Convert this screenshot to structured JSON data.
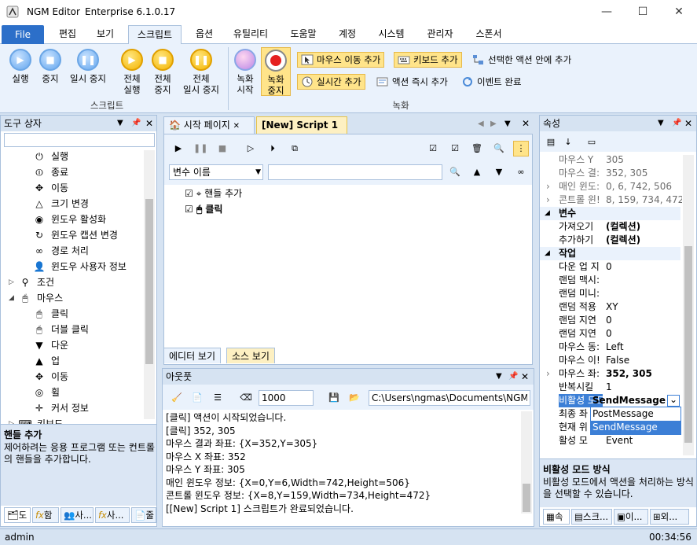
{
  "window": {
    "app": "NGM Editor",
    "edition": "Enterprise 6.1.0.17",
    "minimize": "—",
    "maximize": "☐",
    "close": "✕"
  },
  "menu": [
    {
      "label": "File"
    },
    {
      "label": "편집"
    },
    {
      "label": "보기"
    },
    {
      "label": "스크립트"
    },
    {
      "label": "옵션"
    },
    {
      "label": "유틸리티"
    },
    {
      "label": "도움말"
    },
    {
      "label": "계정"
    },
    {
      "label": "시스템"
    },
    {
      "label": "관리자"
    },
    {
      "label": "스폰서"
    }
  ],
  "ribbon": {
    "script_group": "스크립트",
    "record_group": "녹화",
    "run": "실행",
    "stop": "중지",
    "pause": "일시 중지",
    "run_all": [
      "전체",
      "실행"
    ],
    "stop_all": [
      "전체",
      "중지"
    ],
    "pause_all": [
      "전체",
      "일시 중지"
    ],
    "rec_start": [
      "녹화",
      "시작"
    ],
    "rec_stop": [
      "녹화",
      "중지"
    ],
    "add_mouse_move": "마우스 이동 추가",
    "add_keyboard": "키보드 추가",
    "add_in_selected": "선택한 액션 안에 추가",
    "add_realtime": "실시간 추가",
    "run_action_now": "액션 즉시 추가",
    "event_done": "이벤트 완료"
  },
  "toolbox": {
    "title": "도구 상자",
    "search_placeholder": "",
    "items": [
      {
        "label": "실행",
        "icon": "run-icon"
      },
      {
        "label": "종료",
        "icon": "power-icon"
      },
      {
        "label": "이동",
        "icon": "move-icon"
      },
      {
        "label": "크기 변경",
        "icon": "resize-icon"
      },
      {
        "label": "윈도우 활성화",
        "icon": "activate-icon"
      },
      {
        "label": "윈도우 캡션 변경",
        "icon": "caption-icon"
      },
      {
        "label": "경로 처리",
        "icon": "path-icon"
      },
      {
        "label": "윈도우 사용자 정보",
        "icon": "user-icon"
      },
      {
        "label": "조건",
        "icon": "condition-icon"
      },
      {
        "label": "마우스",
        "icon": "mouse-icon"
      },
      {
        "label": "클릭",
        "icon": "click-icon"
      },
      {
        "label": "더블 클릭",
        "icon": "double-click-icon"
      },
      {
        "label": "다운",
        "icon": "mouse-down-icon"
      },
      {
        "label": "업",
        "icon": "mouse-up-icon"
      },
      {
        "label": "이동",
        "icon": "mouse-move-icon"
      },
      {
        "label": "휠",
        "icon": "wheel-icon"
      },
      {
        "label": "커서 정보",
        "icon": "cursor-icon"
      },
      {
        "label": "키보드",
        "icon": "keyboard-icon"
      }
    ],
    "desc_title": "핸들 추가",
    "desc_text": "제어하려는 응용 프로그램 또는 컨트롤의 핸들을 추가합니다.",
    "tabs": [
      "도",
      "함",
      "사...",
      "사...",
      "줄"
    ]
  },
  "editor": {
    "tabs": [
      {
        "label": "시작 페이지"
      },
      {
        "label": "[New] Script 1"
      }
    ],
    "var_select": "변수 이름",
    "var_input": "",
    "script_items": [
      {
        "label": "핸들 추가",
        "checked": true
      },
      {
        "label": "클릭",
        "checked": true
      }
    ],
    "bottom_tabs": [
      "에디터 보기",
      "소스 보기"
    ]
  },
  "output": {
    "title": "아웃풋",
    "count": "1000",
    "path": "C:\\Users\\ngmas\\Documents\\NGM6\\",
    "lines": [
      "[클릭] 액션이 시작되었습니다.",
      "[클릭] 352, 305",
      "마우스 결과 좌표: {X=352,Y=305}",
      "마우스 X 좌표: 352",
      "마우스 Y 좌표: 305",
      "매인 윈도우 정보: {X=0,Y=6,Width=742,Height=506}",
      "콘트롤 윈도우 정보: {X=8,Y=159,Width=734,Height=472}",
      "[[New] Script 1] 스크립트가 완료되었습니다."
    ]
  },
  "properties": {
    "title": "속성",
    "rows": [
      {
        "type": "row",
        "name": "마우스 Y",
        "value": "305",
        "gray": true
      },
      {
        "type": "row",
        "name": "마우스 결:",
        "value": "352, 305",
        "gray": true
      },
      {
        "type": "row",
        "name": "매인 윈도:",
        "value": "0, 6, 742, 506",
        "gray": true,
        "expand": true
      },
      {
        "type": "row",
        "name": "콘트롤 윈!",
        "value": "8, 159, 734, 472",
        "gray": true,
        "expand": true
      },
      {
        "type": "cat",
        "name": "변수"
      },
      {
        "type": "row",
        "name": "가져오기",
        "value": "(컬렉션)",
        "bold": true
      },
      {
        "type": "row",
        "name": "추가하기",
        "value": "(컬렉션)",
        "bold": true
      },
      {
        "type": "cat",
        "name": "작업"
      },
      {
        "type": "row",
        "name": "다운 업 지",
        "value": "0"
      },
      {
        "type": "row",
        "name": "랜덤 맥시:",
        "value": ""
      },
      {
        "type": "row",
        "name": "랜덤 미니:",
        "value": ""
      },
      {
        "type": "row",
        "name": "랜덤 적용",
        "value": "XY"
      },
      {
        "type": "row",
        "name": "랜덤 지연",
        "value": "0"
      },
      {
        "type": "row",
        "name": "랜덤 지연",
        "value": "0"
      },
      {
        "type": "row",
        "name": "마우스 동:",
        "value": "Left"
      },
      {
        "type": "row",
        "name": "마우스 이!",
        "value": "False"
      },
      {
        "type": "row",
        "name": "마우스 좌:",
        "value": "352, 305",
        "bold": true,
        "expand": true
      },
      {
        "type": "row",
        "name": "반복시킬",
        "value": "1"
      },
      {
        "type": "row",
        "name": "비활성 모드",
        "value": "SendMessage",
        "selected": true
      },
      {
        "type": "row",
        "name": "최종 좌",
        "value": ""
      },
      {
        "type": "row",
        "name": "현재 위",
        "value": ""
      },
      {
        "type": "row",
        "name": "활성 모",
        "value": "Event"
      }
    ],
    "dropdown_options": [
      "PostMessage",
      "SendMessage"
    ],
    "desc_title": "비활성 모드 방식",
    "desc_text": "비활성 모드에서 액션을 처리하는 방식을 선택할 수 있습니다.",
    "tabs": [
      "속",
      "스크...",
      "이...",
      "외..."
    ]
  },
  "status": {
    "user": "admin",
    "time": "00:34:56"
  }
}
